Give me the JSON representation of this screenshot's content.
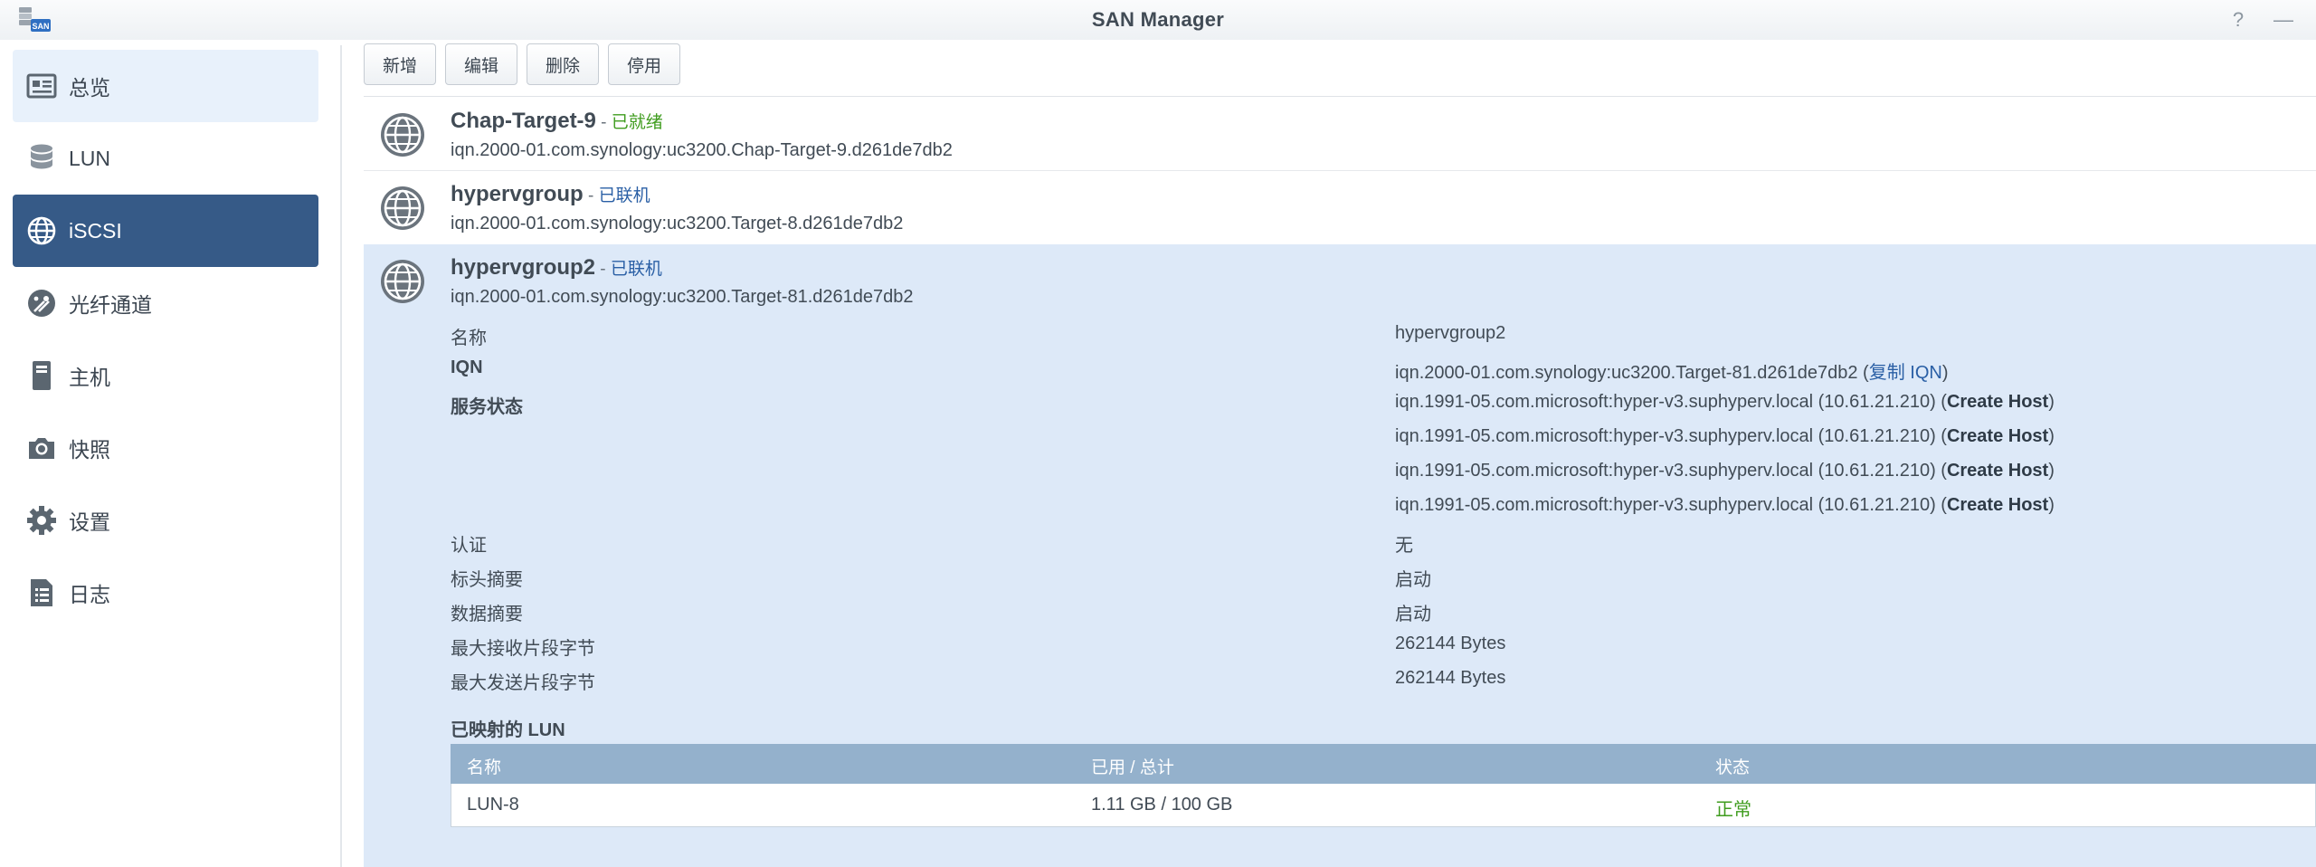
{
  "window": {
    "title": "SAN Manager",
    "app_icon_text": "SAN",
    "help_glyph": "?",
    "minimize_glyph": "—"
  },
  "sidebar": {
    "items": [
      {
        "label": "总览",
        "icon": "overview-icon"
      },
      {
        "label": "LUN",
        "icon": "database-icon"
      },
      {
        "label": "iSCSI",
        "icon": "globe-icon"
      },
      {
        "label": "光纤通道",
        "icon": "fibre-channel-icon"
      },
      {
        "label": "主机",
        "icon": "host-icon"
      },
      {
        "label": "快照",
        "icon": "camera-icon"
      },
      {
        "label": "设置",
        "icon": "gear-icon"
      },
      {
        "label": "日志",
        "icon": "log-icon"
      }
    ],
    "active_index": 2,
    "hover_index": 0
  },
  "toolbar": {
    "add": "新增",
    "edit": "编辑",
    "delete": "删除",
    "disable": "停用"
  },
  "targets": [
    {
      "name": "Chap-Target-9",
      "sep": " - ",
      "status": "已就绪",
      "status_color": "#3f9c1e",
      "iqn": "iqn.2000-01.com.synology:uc3200.Chap-Target-9.d261de7db2"
    },
    {
      "name": "hypervgroup",
      "sep": " - ",
      "status": "已联机",
      "status_color": "#2a5fa5",
      "iqn": "iqn.2000-01.com.synology:uc3200.Target-8.d261de7db2"
    },
    {
      "name": "hypervgroup2",
      "sep": " - ",
      "status": "已联机",
      "status_color": "#2a5fa5",
      "iqn": "iqn.2000-01.com.synology:uc3200.Target-81.d261de7db2"
    }
  ],
  "details": {
    "name_label": "名称",
    "name_value": "hypervgroup2",
    "iqn_label": "IQN",
    "iqn_value": "iqn.2000-01.com.synology:uc3200.Target-81.d261de7db2 (",
    "copy_iqn": "复制 IQN",
    "iqn_close": ")",
    "service_label": "服务状态",
    "service_entries": [
      {
        "initiator": "iqn.1991-05.com.microsoft:hyper-v3.suphyperv.local (10.61.21.210) (",
        "action": "Create Host",
        "close": ")"
      },
      {
        "initiator": "iqn.1991-05.com.microsoft:hyper-v3.suphyperv.local (10.61.21.210) (",
        "action": "Create Host",
        "close": ")"
      },
      {
        "initiator": "iqn.1991-05.com.microsoft:hyper-v3.suphyperv.local (10.61.21.210) (",
        "action": "Create Host",
        "close": ")"
      },
      {
        "initiator": "iqn.1991-05.com.microsoft:hyper-v3.suphyperv.local (10.61.21.210) (",
        "action": "Create Host",
        "close": ")"
      }
    ],
    "auth_label": "认证",
    "auth_value": "无",
    "header_digest_label": "标头摘要",
    "header_digest_value": "启动",
    "data_digest_label": "数据摘要",
    "data_digest_value": "启动",
    "max_recv_label": "最大接收片段字节",
    "max_recv_value": "262144 Bytes",
    "max_send_label": "最大发送片段字节",
    "max_send_value": "262144 Bytes"
  },
  "mapped_lun": {
    "title": "已映射的 LUN",
    "columns": [
      "名称",
      "已用 / 总计",
      "状态"
    ],
    "rows": [
      {
        "name": "LUN-8",
        "usage": "1.11 GB / 100 GB",
        "status": "正常",
        "status_color": "#3f9c1e"
      }
    ]
  }
}
